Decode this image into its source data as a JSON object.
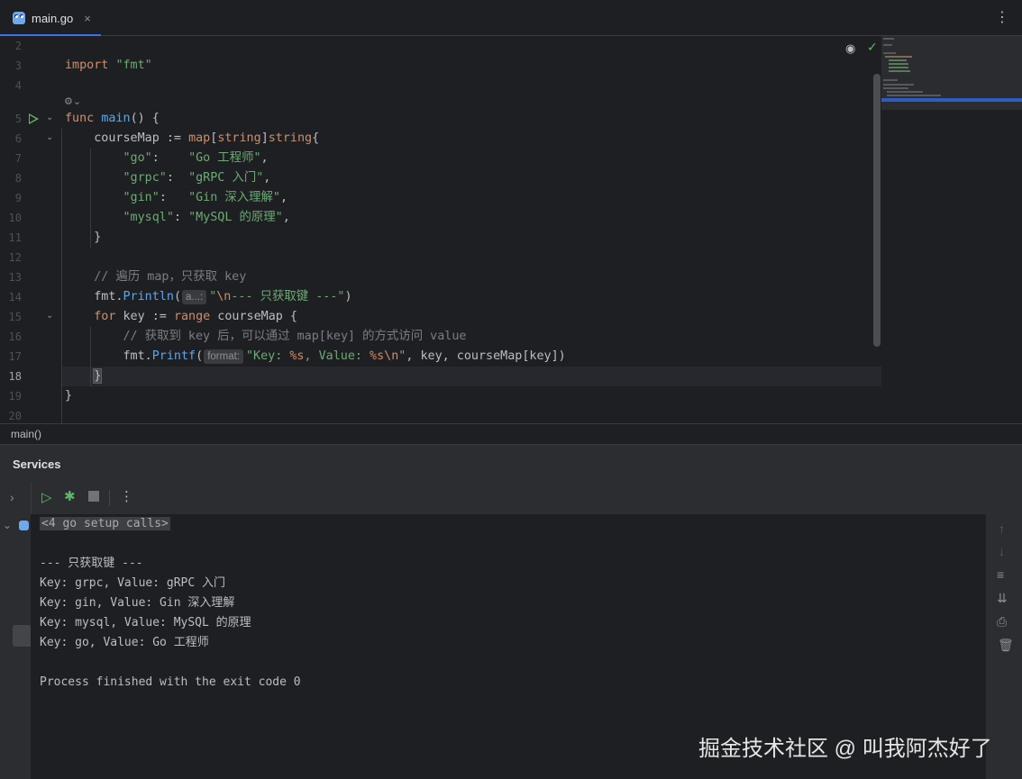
{
  "tab": {
    "label": "main.go",
    "close": "×",
    "more": "⋮"
  },
  "editor": {
    "line_numbers": [
      "2",
      "3",
      "4",
      "5",
      "6",
      "7",
      "8",
      "9",
      "10",
      "11",
      "12",
      "13",
      "14",
      "15",
      "16",
      "17",
      "18",
      "19",
      "20"
    ],
    "current_line": "18",
    "hints": {
      "println_param": "a...:",
      "printf_param": "format:"
    }
  },
  "breadcrumb": {
    "text": "main()"
  },
  "services": {
    "title": "Services",
    "console_lines": [
      "<4 go setup calls>",
      "",
      "--- 只获取键 ---",
      "Key: grpc, Value: gRPC 入门",
      "Key: gin, Value: Gin 深入理解",
      "Key: mysql, Value: MySQL 的原理",
      "Key: go, Value: Go 工程师",
      "",
      "Process finished with the exit code 0"
    ]
  },
  "watermark": "掘金技术社区 @ 叫我阿杰好了"
}
